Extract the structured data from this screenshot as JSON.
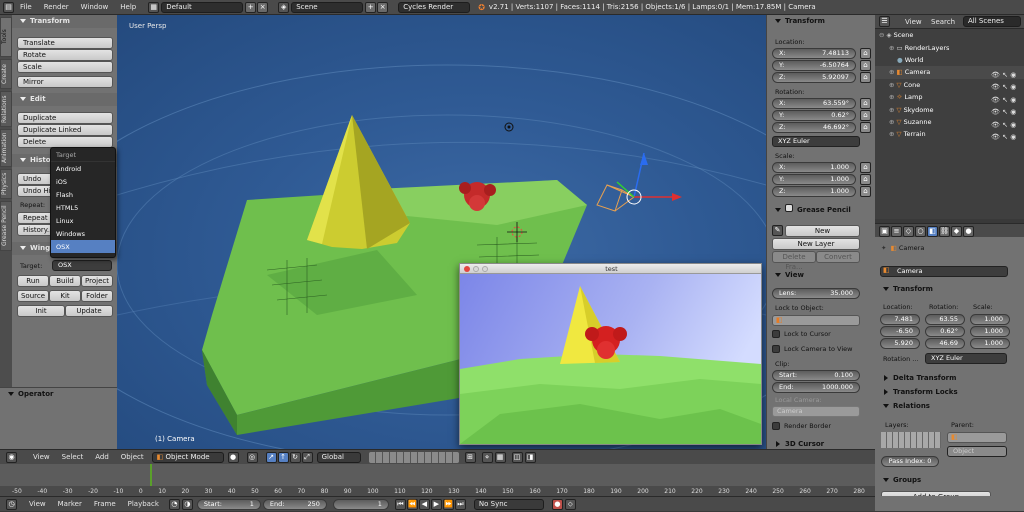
{
  "topbar": {
    "menus": [
      "File",
      "Render",
      "Window",
      "Help"
    ],
    "layout": "Default",
    "scene": "Scene",
    "engine": "Cycles Render",
    "stats": "v2.71 | Verts:1107 | Faces:1114 | Tris:2156 | Objects:1/6 | Lamps:0/1 | Mem:17.85M | Camera"
  },
  "left_tabs": [
    "Tools",
    "Create",
    "Relations",
    "Animation",
    "Physics",
    "Grease Pencil"
  ],
  "tools": {
    "transform_header": "Transform",
    "translate": "Translate",
    "rotate": "Rotate",
    "scale": "Scale",
    "mirror": "Mirror",
    "edit_header": "Edit",
    "duplicate": "Duplicate",
    "duplicate_linked": "Duplicate Linked",
    "delete": "Delete",
    "history_header": "History",
    "undo": "Undo",
    "redo": "Undo Hi",
    "repeat": "Repeat:",
    "repeat_last": "Repeat L",
    "history": "History...",
    "wings_header": "Wings",
    "target_label": "Target:",
    "target_value": "OSX",
    "run": "Run",
    "build": "Build",
    "project": "Project",
    "source": "Source",
    "kit": "Kit",
    "folder": "Folder",
    "init": "Init",
    "update": "Update",
    "operator_header": "Operator"
  },
  "dropdown": {
    "title": "Target",
    "options": [
      "Android",
      "iOS",
      "Flash",
      "HTML5",
      "Linux",
      "Windows",
      "OSX"
    ],
    "selected": "OSX"
  },
  "viewport": {
    "label": "User Persp",
    "object_label": "(1) Camera"
  },
  "test_window": {
    "title": "test"
  },
  "npanel": {
    "transform_header": "Transform",
    "location_label": "Location:",
    "loc_x": "7.48113",
    "loc_y": "-6.50764",
    "loc_z": "5.92097",
    "rotation_label": "Rotation:",
    "rot_x": "63.559°",
    "rot_y": "0.62°",
    "rot_z": "46.692°",
    "rot_mode": "XYZ Euler",
    "scale_label": "Scale:",
    "scale_x": "1.000",
    "scale_y": "1.000",
    "scale_z": "1.000",
    "grease_header": "Grease Pencil",
    "new": "New",
    "new_layer": "New Layer",
    "delete_frame": "Delete Fra...",
    "convert": "Convert",
    "view_header": "View",
    "lens_label": "Lens:",
    "lens": "35.000",
    "lock_label": "Lock to Object:",
    "lock_cursor": "Lock to Cursor",
    "lock_camera": "Lock Camera to View",
    "clip_label": "Clip:",
    "clip_start_label": "Start:",
    "clip_start": "0.100",
    "clip_end_label": "End:",
    "clip_end": "1000.000",
    "local_camera": "Local Camera:",
    "camera_field": "Camera",
    "render_border": "Render Border",
    "cursor_header": "3D Cursor",
    "xl": "X:",
    "yl": "Y:",
    "zl": "Z:"
  },
  "outliner": {
    "view": "View",
    "search": "Search",
    "all_scenes": "All Scenes",
    "items": [
      "Scene",
      "RenderLayers",
      "World",
      "Camera",
      "Cone",
      "Lamp",
      "Skydome",
      "Suzanne",
      "Terrain"
    ]
  },
  "properties": {
    "object": "Camera",
    "object_name": "Camera",
    "transform_header": "Transform",
    "location": "Location:",
    "rotation": "Rotation:",
    "scale": "Scale:",
    "loc": [
      "7.481",
      "-6.50",
      "5.920"
    ],
    "rot": [
      "63.55",
      "0.62°",
      "46.69"
    ],
    "scl": [
      "1.000",
      "1.000",
      "1.000"
    ],
    "rotation_mode_label": "Rotation ...",
    "rotation_mode": "XYZ Euler",
    "delta": "Delta Transform",
    "locks": "Transform Locks",
    "relations": "Relations",
    "layers": "Layers:",
    "parent": "Parent:",
    "parent_field": "Object",
    "pass_index": "Pass Index: 0",
    "groups": "Groups",
    "add_group": "Add to Group"
  },
  "view_header": {
    "view": "View",
    "select": "Select",
    "add": "Add",
    "object": "Object",
    "mode": "Object Mode",
    "orientation": "Global"
  },
  "timeline": {
    "ticks": [
      "-50",
      "-40",
      "-30",
      "-20",
      "-10",
      "0",
      "10",
      "20",
      "30",
      "40",
      "50",
      "60",
      "70",
      "80",
      "90",
      "100",
      "110",
      "120",
      "130",
      "140",
      "150",
      "160",
      "170",
      "180",
      "190",
      "200",
      "210",
      "220",
      "230",
      "240",
      "250",
      "260",
      "270",
      "280"
    ],
    "view": "View",
    "marker": "Marker",
    "frame": "Frame",
    "playback": "Playback",
    "start_label": "Start:",
    "start": "1",
    "end_label": "End:",
    "end": "250",
    "current": "1",
    "sync": "No Sync"
  }
}
